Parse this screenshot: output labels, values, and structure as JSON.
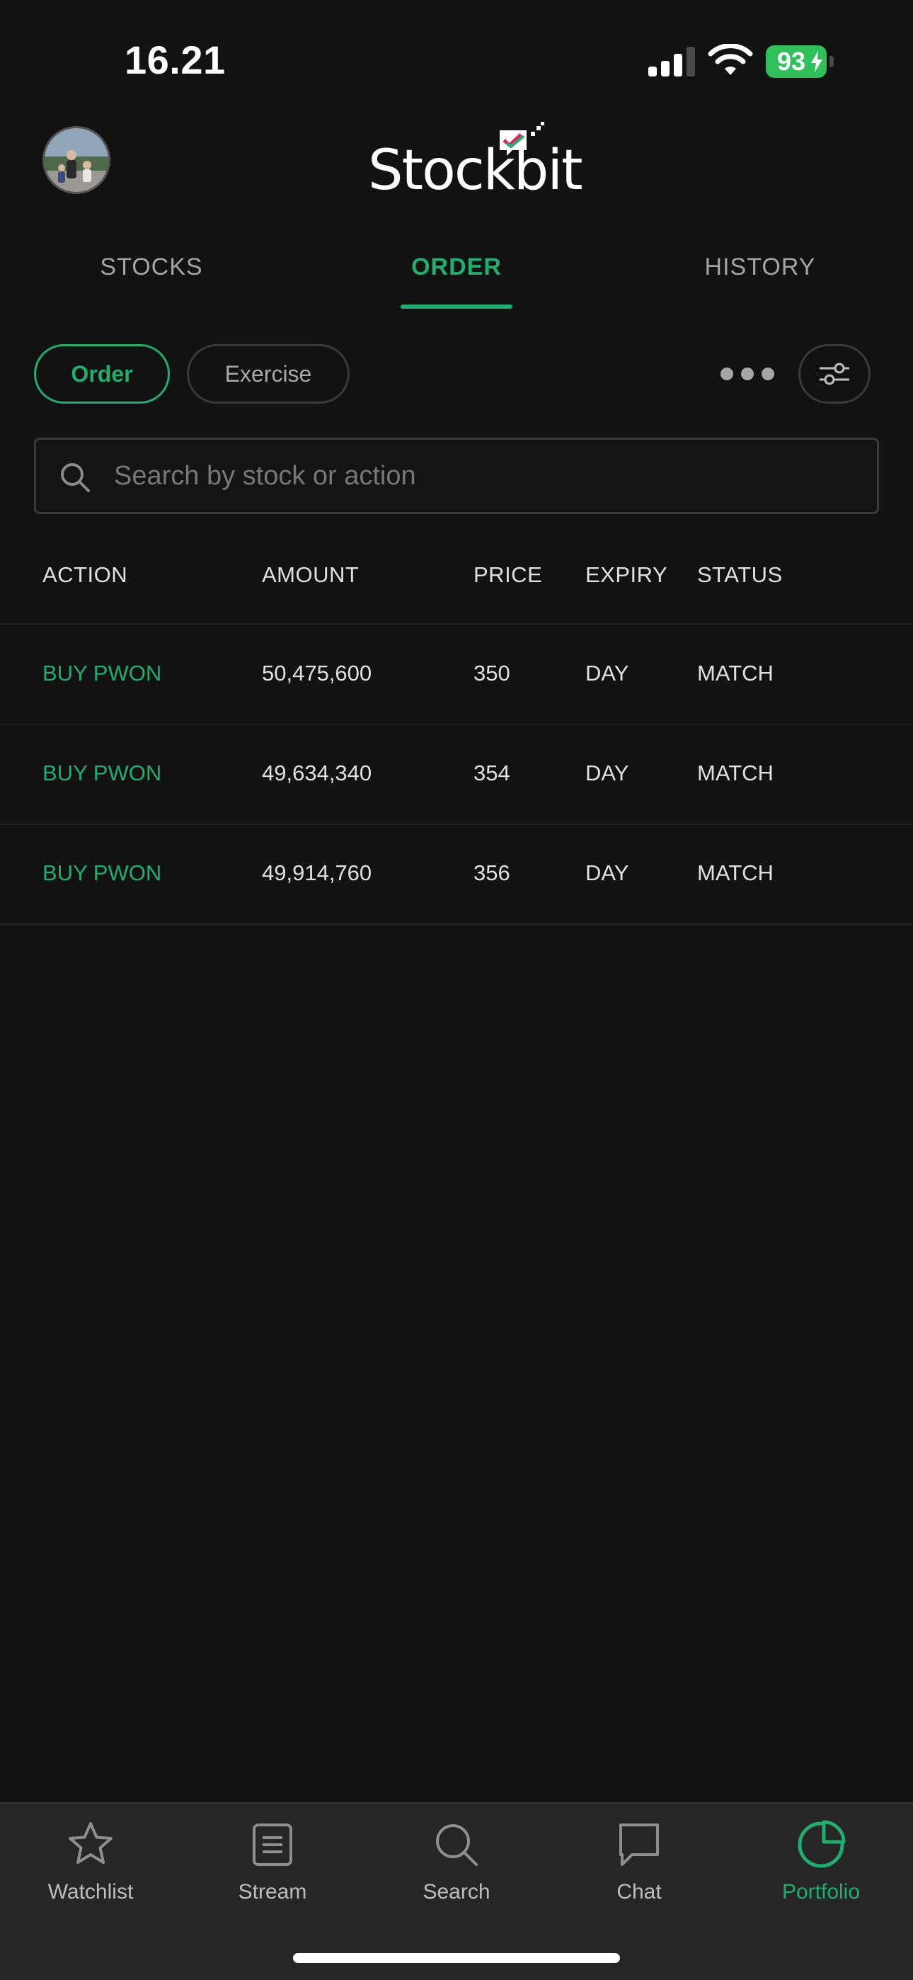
{
  "status_bar": {
    "time": "16.21",
    "battery": "93"
  },
  "header": {
    "logo_text": "Stockbit"
  },
  "tabs": [
    {
      "label": "STOCKS",
      "active": false
    },
    {
      "label": "ORDER",
      "active": true
    },
    {
      "label": "HISTORY",
      "active": false
    }
  ],
  "filters": {
    "order_label": "Order",
    "exercise_label": "Exercise"
  },
  "search": {
    "placeholder": "Search by stock or action",
    "value": ""
  },
  "table": {
    "columns": [
      "ACTION",
      "AMOUNT",
      "PRICE",
      "EXPIRY",
      "STATUS"
    ],
    "rows": [
      {
        "action": "BUY PWON",
        "amount": "50,475,600",
        "price": "350",
        "expiry": "DAY",
        "status": "MATCH"
      },
      {
        "action": "BUY PWON",
        "amount": "49,634,340",
        "price": "354",
        "expiry": "DAY",
        "status": "MATCH"
      },
      {
        "action": "BUY PWON",
        "amount": "49,914,760",
        "price": "356",
        "expiry": "DAY",
        "status": "MATCH"
      }
    ]
  },
  "bottom_nav": [
    {
      "label": "Watchlist",
      "icon": "star-icon",
      "active": false
    },
    {
      "label": "Stream",
      "icon": "stream-icon",
      "active": false
    },
    {
      "label": "Search",
      "icon": "search-icon",
      "active": false
    },
    {
      "label": "Chat",
      "icon": "chat-icon",
      "active": false
    },
    {
      "label": "Portfolio",
      "icon": "pie-chart-icon",
      "active": true
    }
  ],
  "colors": {
    "accent": "#1fae6e",
    "background": "#121212",
    "nav_background": "#262626",
    "battery": "#30c05a"
  }
}
